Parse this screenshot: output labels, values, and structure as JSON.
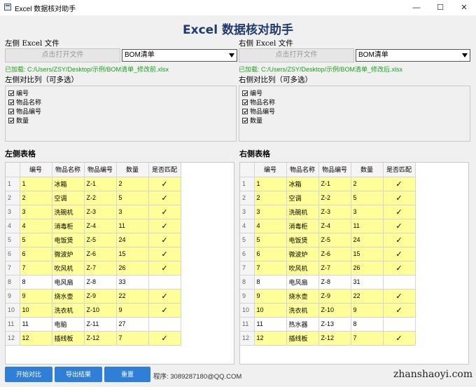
{
  "window": {
    "title": "Excel 数据核对助手",
    "controls": {
      "minimize": "—",
      "maximize": "☐",
      "close": "✕"
    }
  },
  "header": {
    "title": "Excel 数据核对助手"
  },
  "left": {
    "file_label": "左侧 Excel 文件",
    "open_button": "点击打开文件",
    "sheet_select": "BOM清单",
    "loaded_text": "已加载: C:/Users/ZSY/Desktop/示例/BOM清单_修改前.xlsx",
    "compare_label": "左侧对比列（可多选）",
    "columns": [
      "编号",
      "物品名称",
      "物品编号",
      "数量"
    ],
    "table_title": "左侧表格"
  },
  "right": {
    "file_label": "右侧 Excel 文件",
    "open_button": "点击打开文件",
    "sheet_select": "BOM清单",
    "loaded_text": "已加载: C:/Users/ZSY/Desktop/示例/BOM清单_修改后.xlsx",
    "compare_label": "右侧对比列（可多选）",
    "columns": [
      "编号",
      "物品名称",
      "物品编号",
      "数量"
    ],
    "table_title": "右侧表格"
  },
  "table_headers": [
    "编号",
    "物品名称",
    "物品编号",
    "数量",
    "是否匹配"
  ],
  "left_rows": [
    {
      "n": "1",
      "cells": [
        "1",
        "冰箱",
        "Z-1",
        "2",
        "✓"
      ],
      "hl": true
    },
    {
      "n": "2",
      "cells": [
        "2",
        "空调",
        "Z-2",
        "5",
        "✓"
      ],
      "hl": true
    },
    {
      "n": "3",
      "cells": [
        "3",
        "洗碗机",
        "Z-3",
        "3",
        "✓"
      ],
      "hl": true
    },
    {
      "n": "4",
      "cells": [
        "4",
        "消毒柜",
        "Z-4",
        "11",
        "✓"
      ],
      "hl": true
    },
    {
      "n": "5",
      "cells": [
        "5",
        "电饭煲",
        "Z-5",
        "24",
        "✓"
      ],
      "hl": true
    },
    {
      "n": "6",
      "cells": [
        "6",
        "微波炉",
        "Z-6",
        "15",
        "✓"
      ],
      "hl": true
    },
    {
      "n": "7",
      "cells": [
        "7",
        "吹风机",
        "Z-7",
        "26",
        "✓"
      ],
      "hl": true
    },
    {
      "n": "8",
      "cells": [
        "8",
        "电风扇",
        "Z-8",
        "33",
        ""
      ],
      "hl": false
    },
    {
      "n": "9",
      "cells": [
        "9",
        "烧水壶",
        "Z-9",
        "22",
        "✓"
      ],
      "hl": true
    },
    {
      "n": "10",
      "cells": [
        "10",
        "洗衣机",
        "Z-10",
        "9",
        "✓"
      ],
      "hl": true
    },
    {
      "n": "11",
      "cells": [
        "11",
        "电脑",
        "Z-11",
        "27",
        ""
      ],
      "hl": false
    },
    {
      "n": "12",
      "cells": [
        "12",
        "插线板",
        "Z-12",
        "7",
        "✓"
      ],
      "hl": true
    }
  ],
  "right_rows": [
    {
      "n": "1",
      "cells": [
        "1",
        "冰箱",
        "Z-1",
        "2",
        "✓"
      ],
      "hl": true
    },
    {
      "n": "2",
      "cells": [
        "2",
        "空调",
        "Z-2",
        "5",
        "✓"
      ],
      "hl": true
    },
    {
      "n": "3",
      "cells": [
        "3",
        "洗碗机",
        "Z-3",
        "3",
        "✓"
      ],
      "hl": true
    },
    {
      "n": "4",
      "cells": [
        "4",
        "消毒柜",
        "Z-4",
        "11",
        "✓"
      ],
      "hl": true
    },
    {
      "n": "5",
      "cells": [
        "5",
        "电饭煲",
        "Z-5",
        "24",
        "✓"
      ],
      "hl": true
    },
    {
      "n": "6",
      "cells": [
        "6",
        "微波炉",
        "Z-6",
        "15",
        "✓"
      ],
      "hl": true
    },
    {
      "n": "7",
      "cells": [
        "7",
        "吹风机",
        "Z-7",
        "26",
        "✓"
      ],
      "hl": true
    },
    {
      "n": "8",
      "cells": [
        "8",
        "电风扇",
        "Z-8",
        "31",
        ""
      ],
      "hl": false
    },
    {
      "n": "9",
      "cells": [
        "9",
        "烧水壶",
        "Z-9",
        "22",
        "✓"
      ],
      "hl": true
    },
    {
      "n": "10",
      "cells": [
        "10",
        "洗衣机",
        "Z-10",
        "9",
        "✓"
      ],
      "hl": true
    },
    {
      "n": "11",
      "cells": [
        "11",
        "热水器",
        "Z-13",
        "8",
        ""
      ],
      "hl": false
    },
    {
      "n": "12",
      "cells": [
        "12",
        "插线板",
        "Z-12",
        "7",
        "✓"
      ],
      "hl": true
    }
  ],
  "buttons": {
    "start": "开始对比",
    "export": "导出结果",
    "reset": "重置"
  },
  "contact": "程序: 3089287180@QQ.COM",
  "watermark": "zhanshaoyi.com",
  "colors": {
    "accent": "#2f7fd8",
    "match_highlight": "#ffff99",
    "loaded_text": "#1aa31a",
    "title": "#1f3a6e"
  }
}
